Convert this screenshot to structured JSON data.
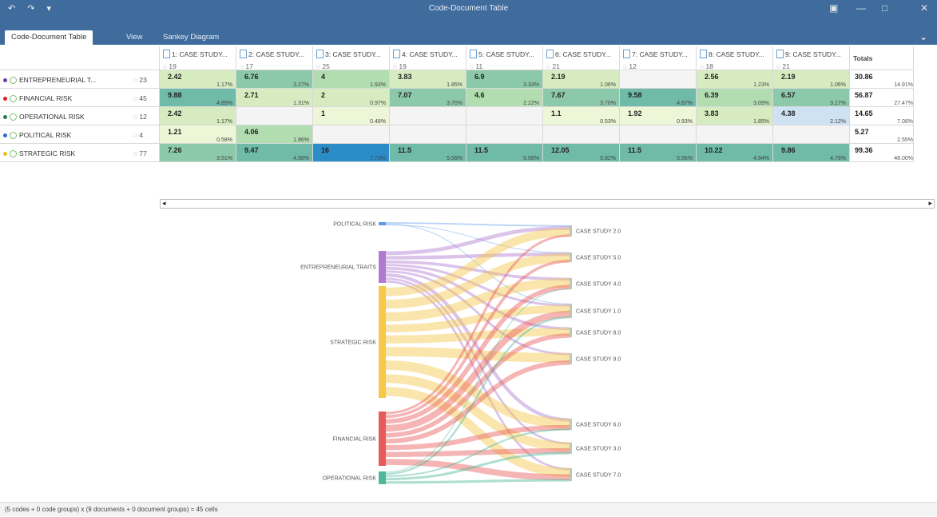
{
  "window": {
    "title": "Code-Document Table",
    "min_icon": "minimize-icon",
    "max_icon": "maximize-icon",
    "close_icon": "close-icon"
  },
  "ribbon": {
    "tabs": [
      "Code-Document Table",
      "View",
      "Sankey Diagram"
    ]
  },
  "table": {
    "columns": [
      {
        "label": "1: CASE STUDY...",
        "count": "19"
      },
      {
        "label": "2: CASE STUDY...",
        "count": "17"
      },
      {
        "label": "3: CASE STUDY...",
        "count": "25"
      },
      {
        "label": "4: CASE STUDY...",
        "count": "19"
      },
      {
        "label": "5: CASE STUDY...",
        "count": "11"
      },
      {
        "label": "6: CASE STUDY...",
        "count": "21"
      },
      {
        "label": "7: CASE STUDY...",
        "count": "12"
      },
      {
        "label": "8: CASE STUDY...",
        "count": "18"
      },
      {
        "label": "9: CASE STUDY...",
        "count": "21"
      }
    ],
    "totals_label": "Totals",
    "rows": [
      {
        "name": "ENTREPRENEURIAL T...",
        "count": "23",
        "dot": "#6b3fa0",
        "cells": [
          [
            "2.42",
            "1.17%"
          ],
          [
            "6.76",
            "3.27%"
          ],
          [
            "4",
            "1.93%"
          ],
          [
            "3.83",
            "1.85%"
          ],
          [
            "6.9",
            "3.33%"
          ],
          [
            "2.19",
            "1.06%"
          ],
          [
            "",
            ""
          ],
          [
            "2.56",
            "1.23%"
          ],
          [
            "2.19",
            "1.06%"
          ]
        ],
        "total": [
          "30.86",
          "14.91%"
        ]
      },
      {
        "name": "FINANCIAL RISK",
        "count": "45",
        "dot": "#e02020",
        "cells": [
          [
            "9.88",
            "4.85%"
          ],
          [
            "2.71",
            "1.31%"
          ],
          [
            "2",
            "0.97%"
          ],
          [
            "7.07",
            "3.70%"
          ],
          [
            "4.6",
            "2.22%"
          ],
          [
            "7.67",
            "3.70%"
          ],
          [
            "9.58",
            "4.67%"
          ],
          [
            "6.39",
            "3.09%"
          ],
          [
            "6.57",
            "3.17%"
          ]
        ],
        "total": [
          "56.87",
          "27.47%"
        ]
      },
      {
        "name": "OPERATIONAL RISK",
        "count": "12",
        "dot": "#2a7a5a",
        "cells": [
          [
            "2.42",
            "1.17%"
          ],
          [
            "",
            ""
          ],
          [
            "1",
            "0.48%"
          ],
          [
            "",
            ""
          ],
          [
            "",
            ""
          ],
          [
            "1.1",
            "0.53%"
          ],
          [
            "1.92",
            "0.93%"
          ],
          [
            "3.83",
            "1.85%"
          ],
          [
            "4.38",
            "2.12%"
          ]
        ],
        "total": [
          "14.65",
          "7.08%"
        ]
      },
      {
        "name": "POLITICAL RISK",
        "count": "4",
        "dot": "#2a6ad0",
        "cells": [
          [
            "1.21",
            "0.58%"
          ],
          [
            "4.06",
            "1.96%"
          ],
          [
            "",
            ""
          ],
          [
            "",
            ""
          ],
          [
            "",
            ""
          ],
          [
            "",
            ""
          ],
          [
            "",
            ""
          ],
          [
            "",
            ""
          ],
          [
            "",
            ""
          ]
        ],
        "total": [
          "5.27",
          "2.55%"
        ]
      },
      {
        "name": "STRATEGIC RISK",
        "count": "77",
        "dot": "#e0c020",
        "cells": [
          [
            "7.26",
            "3.51%"
          ],
          [
            "9.47",
            "4.58%"
          ],
          [
            "16",
            "7.73%"
          ],
          [
            "11.5",
            "5.56%"
          ],
          [
            "11.5",
            "5.56%"
          ],
          [
            "12.05",
            "5.82%"
          ],
          [
            "11.5",
            "5.56%"
          ],
          [
            "10.22",
            "4.94%"
          ],
          [
            "9.86",
            "4.76%"
          ]
        ],
        "total": [
          "99.36",
          "48.00%"
        ]
      }
    ]
  },
  "sankey": {
    "sources": [
      "POLITICAL RISK",
      "ENTREPRENEURIAL TRAITS",
      "STRATEGIC RISK",
      "FINANCIAL RISK",
      "OPERATIONAL RISK"
    ],
    "targets": [
      "CASE STUDY 2.0",
      "CASE STUDY 5.0",
      "CASE STUDY 4.0",
      "CASE STUDY 1.0",
      "CASE STUDY 8.0",
      "CASE STUDY 9.0",
      "CASE STUDY 6.0",
      "CASE STUDY 3.0",
      "CASE STUDY 7.0"
    ],
    "source_colors": [
      "#5b9be8",
      "#b07ad0",
      "#f5c84a",
      "#e85a5a",
      "#4db89a"
    ]
  },
  "status": {
    "text": "(5 codes + 0 code groups) x (9 documents + 0 document groups) = 45 cells"
  }
}
